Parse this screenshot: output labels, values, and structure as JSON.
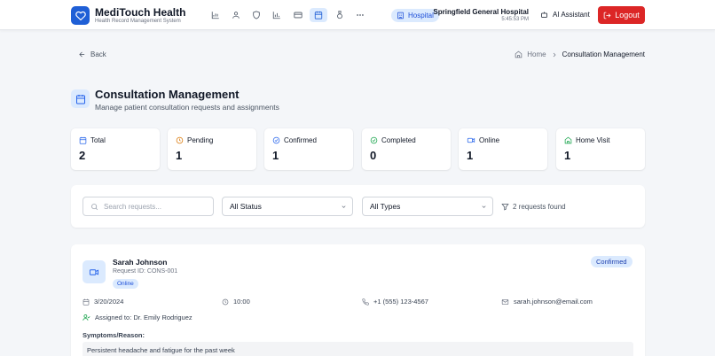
{
  "header": {
    "brand_title": "MediTouch Health",
    "brand_subtitle": "Health Record Management System",
    "nav_icons": [
      "chart-icon",
      "user-icon",
      "shield-icon",
      "bar-chart-icon",
      "card-icon",
      "calendar-icon",
      "medal-icon",
      "more-icon"
    ],
    "active_nav": "calendar-icon",
    "hospital_badge": "Hospital",
    "hospital_name": "Springfield General Hospital",
    "time": "5:45:53 PM",
    "ai_label": "AI Assistant",
    "logout_label": "Logout"
  },
  "nav": {
    "back_label": "Back",
    "breadcrumb_home": "Home",
    "breadcrumb_current": "Consultation Management"
  },
  "page": {
    "title": "Consultation Management",
    "subtitle": "Manage patient consultation requests and assignments"
  },
  "stats": [
    {
      "label": "Total",
      "value": "2",
      "icon": "calendar-icon",
      "color": "#2563eb"
    },
    {
      "label": "Pending",
      "value": "1",
      "icon": "clock-icon",
      "color": "#d97706"
    },
    {
      "label": "Confirmed",
      "value": "1",
      "icon": "check-circle-icon",
      "color": "#2563eb"
    },
    {
      "label": "Completed",
      "value": "0",
      "icon": "check-circle-icon",
      "color": "#16a34a"
    },
    {
      "label": "Online",
      "value": "1",
      "icon": "video-icon",
      "color": "#2563eb"
    },
    {
      "label": "Home Visit",
      "value": "1",
      "icon": "home-icon",
      "color": "#16a34a"
    }
  ],
  "filters": {
    "search_placeholder": "Search requests...",
    "status_selected": "All Status",
    "type_selected": "All Types",
    "results_text": "2 requests found"
  },
  "consultations": [
    {
      "name": "Sarah Johnson",
      "request_id": "Request ID: CONS-001",
      "type": "Online",
      "status": "Confirmed",
      "date": "3/20/2024",
      "time": "10:00",
      "phone": "+1 (555) 123-4567",
      "email": "sarah.johnson@email.com",
      "assigned": "Assigned to: Dr. Emily Rodriguez",
      "symptoms_label": "Symptoms/Reason:",
      "symptoms": "Persistent headache and fatigue for the past week"
    }
  ],
  "colors": {
    "primary": "#1f5fd6",
    "danger": "#dc2626",
    "accent_bg": "#dbeafe"
  }
}
